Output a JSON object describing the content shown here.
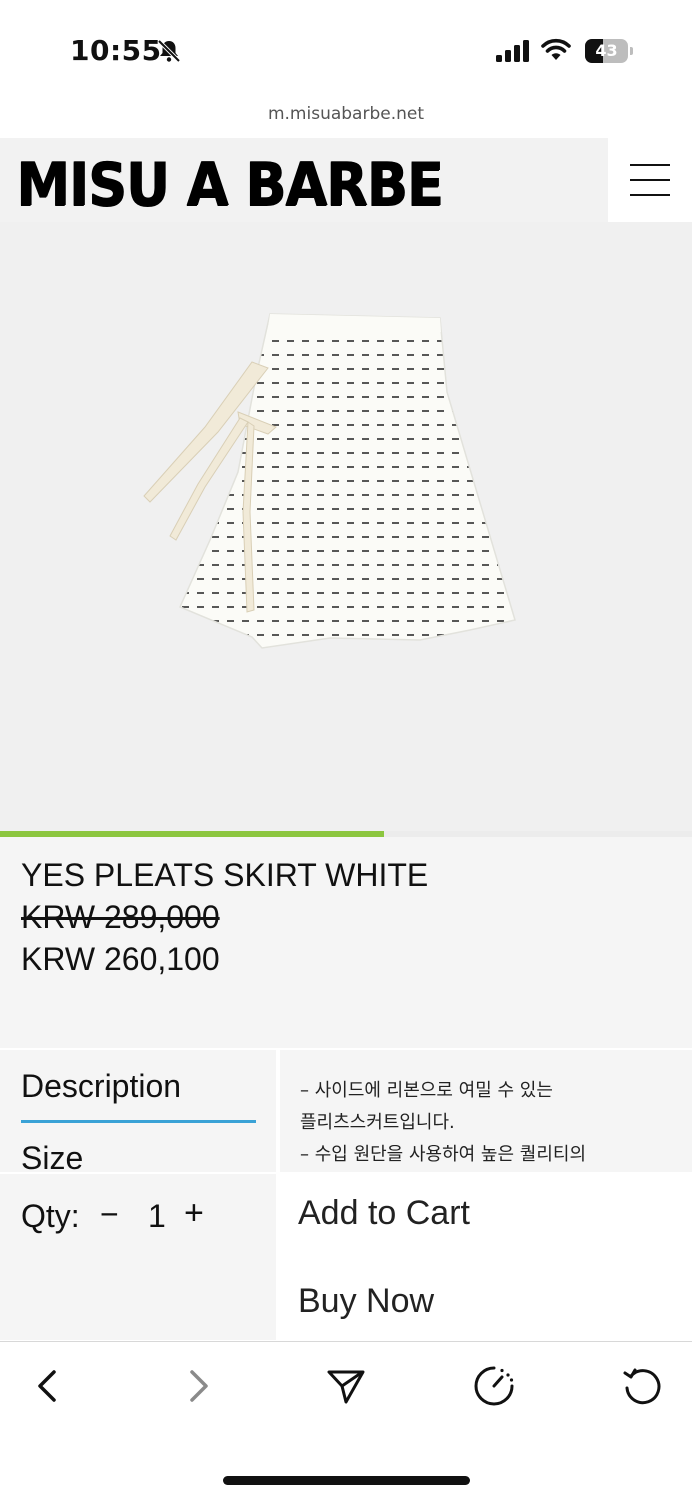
{
  "status_bar": {
    "time": "10:55",
    "battery_level": "43",
    "battery_fraction": 0.43
  },
  "browser": {
    "url": "m.misuabarbe.net"
  },
  "header": {
    "logo": "MISU A BARBE"
  },
  "gallery": {
    "progress_fraction": 0.555
  },
  "product": {
    "name": "YES PLEATS SKIRT WHITE",
    "original_price": "KRW 289,000",
    "sale_price": "KRW 260,100"
  },
  "tabs": [
    {
      "label": "Description",
      "active": true
    },
    {
      "label": "Size",
      "active": false
    }
  ],
  "description_lines": [
    "– 사이드에 리본으로 여밀 수 있는",
    "플리츠스커트입니다.",
    "– 수입 원단을 사용하여 높은 퀄리티의"
  ],
  "quantity": {
    "label": "Qty:",
    "minus": "−",
    "value": "1",
    "plus": "+"
  },
  "actions": {
    "add_to_cart": "Add to Cart",
    "buy_now": "Buy Now"
  },
  "icons": {
    "status": [
      "bell-slash-icon",
      "cellular-signal-icon",
      "wifi-icon",
      "battery-icon"
    ],
    "header": [
      "hamburger-menu-icon"
    ],
    "toolbar": [
      "back-icon",
      "forward-icon",
      "share-icon",
      "speed-dial-icon",
      "reload-icon"
    ]
  },
  "colors": {
    "accent_progress": "#8cc63f",
    "tab_underline": "#3aa2d6",
    "panel_bg": "#f5f5f5"
  }
}
